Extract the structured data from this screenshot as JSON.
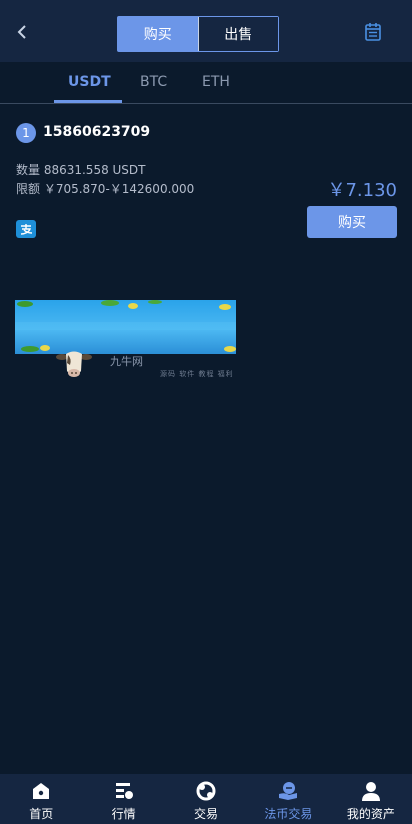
{
  "header": {
    "segments": [
      {
        "label": "购买",
        "active": true
      },
      {
        "label": "出售",
        "active": false
      }
    ]
  },
  "coin_tabs": [
    {
      "label": "USDT",
      "active": true
    },
    {
      "label": "BTC",
      "active": false
    },
    {
      "label": "ETH",
      "active": false
    }
  ],
  "listing": {
    "index": "1",
    "trader": "15860623709",
    "quantity": "数量 88631.558 USDT",
    "limit": "限额 ￥705.870-￥142600.000",
    "price": "￥7.130",
    "payment_icon": "alipay-icon",
    "buy_label": "购买"
  },
  "watermark": {
    "main": "九牛网",
    "sub": "源码 软件 教程 福利"
  },
  "bottom_nav": [
    {
      "label": "首页",
      "icon": "home-icon",
      "active": false
    },
    {
      "label": "行情",
      "icon": "market-icon",
      "active": false
    },
    {
      "label": "交易",
      "icon": "trade-icon",
      "active": false
    },
    {
      "label": "法币交易",
      "icon": "fiat-trade-icon",
      "active": true
    },
    {
      "label": "我的资产",
      "icon": "user-assets-icon",
      "active": false
    }
  ],
  "colors": {
    "accent": "#6c96e8",
    "background": "#0b1a2c",
    "header": "#152641"
  }
}
